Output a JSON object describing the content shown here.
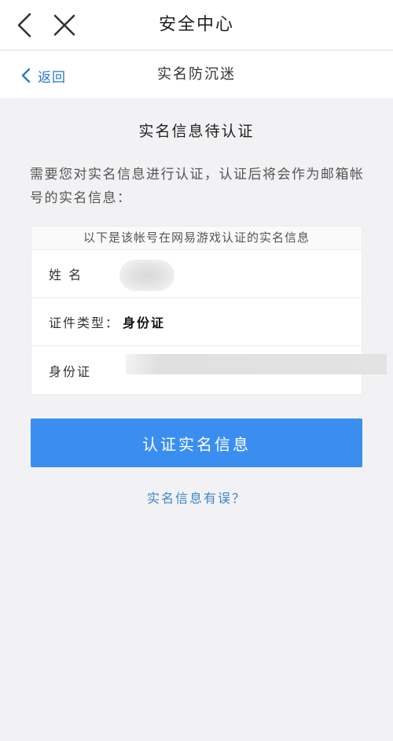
{
  "header": {
    "title": "安全中心",
    "back_icon": "chevron-left-icon",
    "close_icon": "close-icon"
  },
  "subheader": {
    "return_label": "返回",
    "title": "实名防沉迷"
  },
  "main": {
    "heading": "实名信息待认证",
    "description": "需要您对实名信息进行认证，认证后将会作为邮箱帐号的实名信息：",
    "card_note": "以下是该帐号在网易游戏认证的实名信息",
    "rows": [
      {
        "label": "姓 名",
        "value": ""
      },
      {
        "label": "证件类型：",
        "value": "身份证"
      },
      {
        "label": "身份证",
        "value": ""
      }
    ],
    "confirm_button": "认证实名信息",
    "error_link": "实名信息有误？"
  },
  "colors": {
    "accent": "#3a8ef0",
    "link": "#2a78c8",
    "background": "#f2f2f4"
  }
}
